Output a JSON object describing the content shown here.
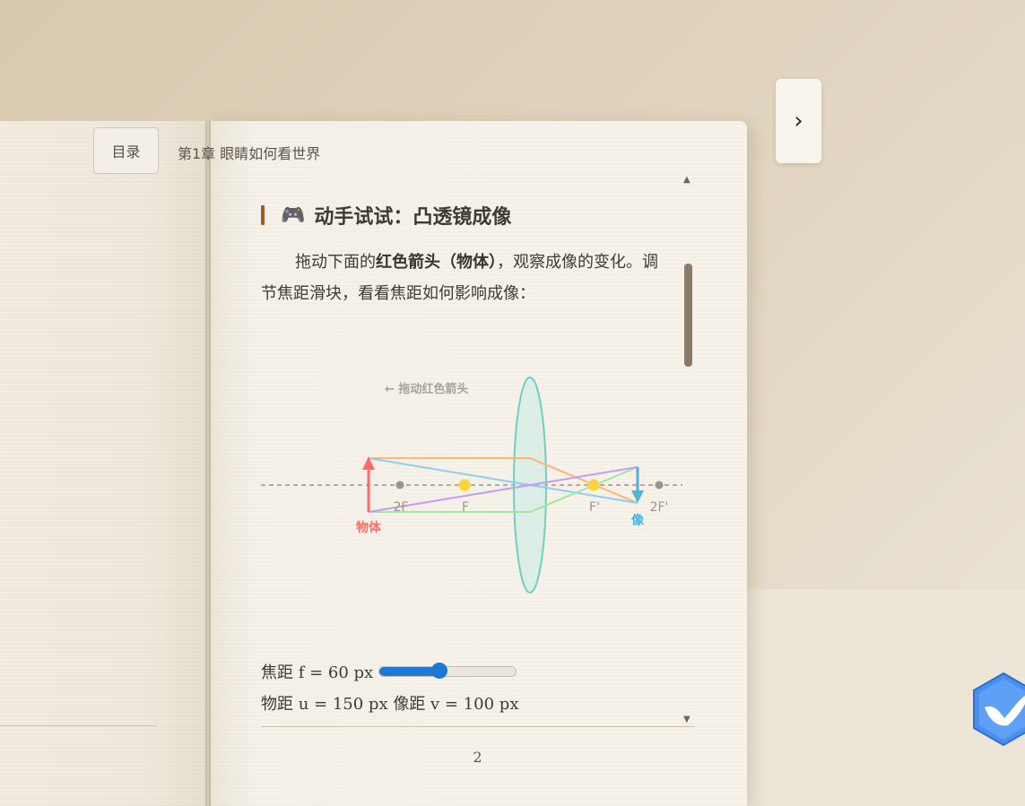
{
  "header": {
    "toc_button": "目录",
    "chapter_title": "第1章 眼睛如何看世界",
    "next_button": "›"
  },
  "section": {
    "icon": "gamepad-icon",
    "title": "动手试试：凸透镜成像"
  },
  "paragraph": {
    "part1": "拖动下面的",
    "bold": "红色箭头（物体）",
    "part2": "，观察成像的变化。调节焦距滑块，看看焦距如何影响成像："
  },
  "diagram": {
    "hint": "← 拖动红色箭头",
    "object_label": "物体",
    "image_label": "像",
    "focal_labels": [
      "2F",
      "F",
      "F'",
      "2F'"
    ],
    "colors": {
      "object": "#ff6b6b",
      "image": "#4fb3d9",
      "lens": "#6fcfc0",
      "focus_point": "#ffd43b",
      "ray_orange": "#ffb570",
      "ray_blue": "#8ecdf0",
      "ray_purple": "#c39bf5",
      "ray_green": "#9fe89a"
    }
  },
  "controls": {
    "focal_label": "焦距 f = 60 px",
    "focal_fraction": 0.44,
    "distance_text": "物距 u = 150 px 像距 v = 100 px"
  },
  "footer": {
    "page_number": "2"
  },
  "scrollbar": {
    "up_icon": "▲",
    "down_icon": "▼"
  }
}
